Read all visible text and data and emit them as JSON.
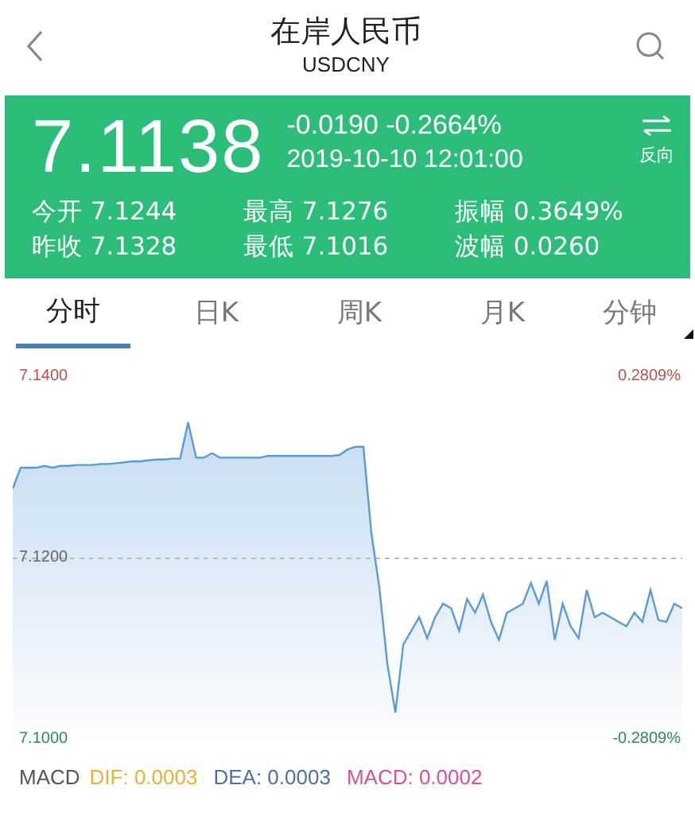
{
  "header": {
    "title": "在岸人民币",
    "subtitle": "USDCNY"
  },
  "quote": {
    "price": "7.1138",
    "change": "-0.0190 -0.2664%",
    "time": "2019-10-10 12:01:00",
    "reverse_label": "反向"
  },
  "stats": [
    {
      "label": "今开",
      "value": "7.1244"
    },
    {
      "label": "最高",
      "value": "7.1276"
    },
    {
      "label": "振幅",
      "value": "0.3649%"
    },
    {
      "label": "昨收",
      "value": "7.1328"
    },
    {
      "label": "最低",
      "value": "7.1016"
    },
    {
      "label": "波幅",
      "value": "0.0260"
    }
  ],
  "tabs": [
    {
      "label": "分时",
      "selected": true
    },
    {
      "label": "日K",
      "selected": false
    },
    {
      "label": "周K",
      "selected": false
    },
    {
      "label": "月K",
      "selected": false
    },
    {
      "label": "分钟",
      "selected": false
    }
  ],
  "chart": {
    "percent_labels": [
      "0.2809%",
      "-0.2809%"
    ],
    "chart_data": {
      "type": "area",
      "ylim": [
        7.1,
        7.14
      ],
      "yticks": [
        {
          "value": 7.14,
          "label": "7.1400"
        },
        {
          "value": 7.12,
          "label": "7.1200"
        },
        {
          "value": 7.1,
          "label": "7.1000"
        }
      ],
      "series": [
        {
          "color": "#5b9bd5",
          "values": [
            7.1277,
            7.13,
            7.13,
            7.13,
            7.1302,
            7.13,
            7.1302,
            7.1302,
            7.1303,
            7.1303,
            7.1303,
            7.1304,
            7.1304,
            7.1305,
            7.1306,
            7.1307,
            7.1307,
            7.1308,
            7.1309,
            7.1309,
            7.131,
            7.131,
            7.135,
            7.1311,
            7.1311,
            7.1316,
            7.1311,
            7.1311,
            7.1311,
            7.1311,
            7.1311,
            7.1311,
            7.1313,
            7.1313,
            7.1313,
            7.1313,
            7.1313,
            7.1313,
            7.1313,
            7.1313,
            7.1313,
            7.1314,
            7.132,
            7.1323,
            7.1323,
            7.1228,
            7.1168,
            7.1083,
            7.103,
            7.1105,
            7.112,
            7.1135,
            7.1112,
            7.1135,
            7.115,
            7.1145,
            7.112,
            7.1155,
            7.114,
            7.116,
            7.113,
            7.111,
            7.114,
            7.1145,
            7.115,
            7.1173,
            7.115,
            7.1175,
            7.111,
            7.115,
            7.1125,
            7.1112,
            7.1165,
            7.1135,
            7.114,
            7.1135,
            7.113,
            7.1125,
            7.114,
            7.113,
            7.1165,
            7.1132,
            7.113,
            7.115,
            7.1145
          ]
        }
      ]
    }
  },
  "macd": [
    {
      "label": "MACD",
      "kind": "title"
    },
    {
      "label": "DIF: 0.0003",
      "kind": "value",
      "color": "#e3b23c"
    },
    {
      "label": "DEA: 0.0003",
      "kind": "value",
      "color": "#4f6fa8"
    },
    {
      "label": "MACD: 0.0002",
      "kind": "value",
      "color": "#d6509e"
    }
  ]
}
